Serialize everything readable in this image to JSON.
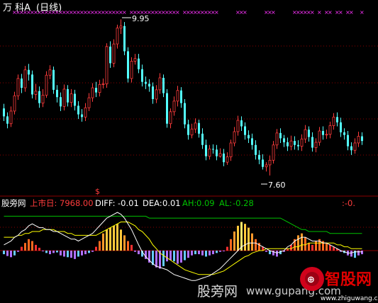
{
  "header": {
    "stock_name": "万 科A",
    "period": "(日线)"
  },
  "price_panel": {
    "high_label": "9.95",
    "low_label": "7.60",
    "signal_glyph": "$"
  },
  "indicator_bar": {
    "name": "股旁网",
    "listing_label": "上市日:",
    "listing_value": "7968.00",
    "diff_label": "DIFF:",
    "diff_value": "-0.01",
    "dea_label": "DEA:",
    "dea_value": "0.01",
    "ah_label": "AH:",
    "ah_value": "0.09",
    "al_label": "AL:",
    "al_value": "-0.28",
    "right_value": ":-0."
  },
  "watermark": {
    "main": "股旁网",
    "domain": "www.gupang.com",
    "site_big": "智股网",
    "site_url": "www.zhiguwang.com"
  },
  "colors": {
    "up": "#ff3c3c",
    "down": "#54ffff",
    "grid": "#8b0000",
    "marker": "#ff33ff",
    "diff": "#ffffff",
    "dea": "#ffff00",
    "ah_color": "#00c000",
    "neg_hist": "#b070ff",
    "neg_hist2": "#66ccff"
  },
  "chart_data": {
    "type": "candlestick",
    "price_range": [
      7.45,
      10.05
    ],
    "candles": [
      [
        8.61,
        8.49,
        8.68,
        8.42
      ],
      [
        8.49,
        8.38,
        8.55,
        8.31
      ],
      [
        8.38,
        8.57,
        8.64,
        8.33
      ],
      [
        8.57,
        8.8,
        8.86,
        8.52
      ],
      [
        8.8,
        9.06,
        9.12,
        8.74
      ],
      [
        9.06,
        8.92,
        9.13,
        8.84
      ],
      [
        8.92,
        9.19,
        9.25,
        8.86
      ],
      [
        9.19,
        9.12,
        9.28,
        9.03
      ],
      [
        9.12,
        8.82,
        9.18,
        8.76
      ],
      [
        8.82,
        8.87,
        8.98,
        8.74
      ],
      [
        8.87,
        8.69,
        8.94,
        8.62
      ],
      [
        8.69,
        8.81,
        8.9,
        8.63
      ],
      [
        8.81,
        9.11,
        9.17,
        8.77
      ],
      [
        9.11,
        9.19,
        9.26,
        9.05
      ],
      [
        9.19,
        8.89,
        9.24,
        8.83
      ],
      [
        8.89,
        8.78,
        8.96,
        8.7
      ],
      [
        8.78,
        8.64,
        8.85,
        8.57
      ],
      [
        8.64,
        8.9,
        8.97,
        8.58
      ],
      [
        8.9,
        8.7,
        8.96,
        8.64
      ],
      [
        8.7,
        8.83,
        8.9,
        8.63
      ],
      [
        8.83,
        8.65,
        8.89,
        8.58
      ],
      [
        8.65,
        8.52,
        8.72,
        8.45
      ],
      [
        8.52,
        8.48,
        8.6,
        8.41
      ],
      [
        8.48,
        8.62,
        8.69,
        8.42
      ],
      [
        8.62,
        8.77,
        8.84,
        8.57
      ],
      [
        8.77,
        8.92,
        8.99,
        8.71
      ],
      [
        8.92,
        8.85,
        9.01,
        8.78
      ],
      [
        8.85,
        8.97,
        9.04,
        8.79
      ],
      [
        8.97,
        8.98,
        9.06,
        8.91
      ],
      [
        8.98,
        9.54,
        9.59,
        8.92
      ],
      [
        9.54,
        9.29,
        9.62,
        9.22
      ],
      [
        9.29,
        9.58,
        9.65,
        9.23
      ],
      [
        9.58,
        9.82,
        9.87,
        9.51
      ],
      [
        9.82,
        9.85,
        9.95,
        9.73
      ],
      [
        9.85,
        9.47,
        9.91,
        9.41
      ],
      [
        9.47,
        9.06,
        9.53,
        9.0
      ],
      [
        9.06,
        9.32,
        9.38,
        9.0
      ],
      [
        9.32,
        9.36,
        9.43,
        9.27
      ],
      [
        9.36,
        9.2,
        9.43,
        9.14
      ],
      [
        9.2,
        9.01,
        9.27,
        8.94
      ],
      [
        9.01,
        8.98,
        9.09,
        8.9
      ],
      [
        8.98,
        8.94,
        9.05,
        8.86
      ],
      [
        8.94,
        8.75,
        9.0,
        8.68
      ],
      [
        8.75,
        8.89,
        8.96,
        8.69
      ],
      [
        8.89,
        9.07,
        9.14,
        8.83
      ],
      [
        9.07,
        8.84,
        9.12,
        8.78
      ],
      [
        8.84,
        8.38,
        8.9,
        8.32
      ],
      [
        8.38,
        8.56,
        8.61,
        8.31
      ],
      [
        8.56,
        8.72,
        8.79,
        8.5
      ],
      [
        8.72,
        8.88,
        8.95,
        8.64
      ],
      [
        8.88,
        8.69,
        8.93,
        8.62
      ],
      [
        8.69,
        8.37,
        8.75,
        8.31
      ],
      [
        8.37,
        8.21,
        8.44,
        8.14
      ],
      [
        8.21,
        8.3,
        8.38,
        8.16
      ],
      [
        8.3,
        8.39,
        8.46,
        8.24
      ],
      [
        8.39,
        8.23,
        8.44,
        8.17
      ],
      [
        8.23,
        8.06,
        8.31,
        8.0
      ],
      [
        8.06,
        7.89,
        8.14,
        7.83
      ],
      [
        7.89,
        8.0,
        8.06,
        7.84
      ],
      [
        8.0,
        7.99,
        8.07,
        7.93
      ],
      [
        7.99,
        7.89,
        8.06,
        7.83
      ],
      [
        7.89,
        7.93,
        8.01,
        7.87
      ],
      [
        7.93,
        7.8,
        8.0,
        7.74
      ],
      [
        7.8,
        7.88,
        7.95,
        7.76
      ],
      [
        7.88,
        8.09,
        8.14,
        7.82
      ],
      [
        8.09,
        8.26,
        8.33,
        8.04
      ],
      [
        8.26,
        8.43,
        8.5,
        8.2
      ],
      [
        8.43,
        8.34,
        8.49,
        8.27
      ],
      [
        8.34,
        8.21,
        8.4,
        8.14
      ],
      [
        8.21,
        8.16,
        8.28,
        8.09
      ],
      [
        8.16,
        8.06,
        8.23,
        7.99
      ],
      [
        8.06,
        7.91,
        8.13,
        7.84
      ],
      [
        7.91,
        7.84,
        7.98,
        7.77
      ],
      [
        7.84,
        7.73,
        7.92,
        7.69
      ],
      [
        7.73,
        7.76,
        7.8,
        7.66
      ],
      [
        7.76,
        7.83,
        7.9,
        7.6
      ],
      [
        7.83,
        8.06,
        8.12,
        7.78
      ],
      [
        8.06,
        8.24,
        8.3,
        8.0
      ],
      [
        8.24,
        8.16,
        8.31,
        8.09
      ],
      [
        8.16,
        8.1,
        8.21,
        8.03
      ],
      [
        8.1,
        8.04,
        8.17,
        7.97
      ],
      [
        8.04,
        8.12,
        8.2,
        7.98
      ],
      [
        8.12,
        8.06,
        8.19,
        7.99
      ],
      [
        8.06,
        8.04,
        8.13,
        7.98
      ],
      [
        8.04,
        8.15,
        8.22,
        7.97
      ],
      [
        8.15,
        8.29,
        8.36,
        8.09
      ],
      [
        8.29,
        8.18,
        8.34,
        8.11
      ],
      [
        8.18,
        8.02,
        8.25,
        7.96
      ],
      [
        8.02,
        8.1,
        8.16,
        7.95
      ],
      [
        8.1,
        8.27,
        8.33,
        8.05
      ],
      [
        8.27,
        8.21,
        8.34,
        8.14
      ],
      [
        8.21,
        8.22,
        8.29,
        8.15
      ],
      [
        8.22,
        8.35,
        8.41,
        8.16
      ],
      [
        8.35,
        8.48,
        8.54,
        8.29
      ],
      [
        8.48,
        8.4,
        8.55,
        8.34
      ],
      [
        8.4,
        8.25,
        8.47,
        8.18
      ],
      [
        8.25,
        8.21,
        8.31,
        8.14
      ],
      [
        8.21,
        8.04,
        8.27,
        7.98
      ],
      [
        8.04,
        7.98,
        8.1,
        7.91
      ],
      [
        7.98,
        8.09,
        8.16,
        7.93
      ],
      [
        8.09,
        8.19,
        8.26,
        8.03
      ],
      [
        8.19,
        8.12,
        8.25,
        8.06
      ]
    ],
    "markers": [
      3,
      4,
      5,
      6,
      7,
      8,
      9,
      10,
      11,
      12,
      13,
      14,
      15,
      16,
      17,
      18,
      19,
      20,
      21,
      22,
      23,
      24,
      25,
      26,
      27,
      28,
      29,
      30,
      31,
      32,
      33,
      34,
      36,
      37,
      38,
      39,
      40,
      41,
      42,
      43,
      44,
      45,
      46,
      47,
      48,
      49,
      51,
      52,
      53,
      54,
      55,
      56,
      57,
      58,
      59,
      60,
      66,
      67,
      68,
      74,
      75,
      76,
      82,
      83,
      84,
      85,
      86,
      87,
      89,
      91,
      92,
      94,
      95,
      97,
      98,
      101
    ],
    "macd": [
      -0.03,
      -0.045,
      -0.055,
      -0.04,
      -0.01,
      0.02,
      0.04,
      0.06,
      0.05,
      0.03,
      0.015,
      -0.005,
      -0.02,
      -0.03,
      -0.02,
      -0.015,
      -0.04,
      -0.05,
      -0.055,
      -0.06,
      -0.07,
      -0.05,
      -0.04,
      -0.03,
      -0.02,
      -0.01,
      0.02,
      0.05,
      0.09,
      0.11,
      0.12,
      0.13,
      0.14,
      0.11,
      0.08,
      0.05,
      0.03,
      -0.01,
      -0.03,
      -0.05,
      -0.07,
      -0.1,
      -0.12,
      -0.14,
      -0.15,
      -0.13,
      -0.09,
      -0.08,
      -0.09,
      -0.11,
      -0.1,
      -0.08,
      -0.06,
      -0.04,
      -0.03,
      -0.03,
      -0.04,
      -0.05,
      -0.04,
      -0.03,
      -0.02,
      -0.01,
      -0.005,
      0.02,
      0.06,
      0.1,
      0.13,
      0.15,
      0.14,
      0.12,
      0.09,
      0.06,
      0.04,
      0.02,
      -0.01,
      -0.03,
      -0.04,
      -0.05,
      -0.03,
      -0.01,
      0.01,
      0.03,
      0.06,
      0.08,
      0.09,
      0.07,
      0.04,
      0.03,
      0.05,
      0.06,
      0.05,
      0.04,
      0.03,
      0.02,
      0.01,
      -0.01,
      -0.02,
      -0.04,
      -0.05,
      -0.06,
      -0.04,
      -0.03
    ],
    "macd_range": [
      -0.26,
      0.2
    ],
    "diff_line": [
      0.03,
      0.04,
      0.05,
      0.07,
      0.08,
      0.1,
      0.11,
      0.13,
      0.14,
      0.13,
      0.12,
      0.12,
      0.11,
      0.11,
      0.1,
      0.1,
      0.09,
      0.08,
      0.07,
      0.06,
      0.06,
      0.05,
      0.06,
      0.07,
      0.08,
      0.09,
      0.11,
      0.13,
      0.15,
      0.17,
      0.18,
      0.19,
      0.2,
      0.19,
      0.17,
      0.14,
      0.11,
      0.07,
      0.03,
      -0.01,
      -0.05,
      -0.08,
      -0.11,
      -0.13,
      -0.14,
      -0.15,
      -0.16,
      -0.18,
      -0.2,
      -0.21,
      -0.22,
      -0.23,
      -0.24,
      -0.25,
      -0.25,
      -0.24,
      -0.23,
      -0.22,
      -0.21,
      -0.19,
      -0.17,
      -0.15,
      -0.12,
      -0.09,
      -0.06,
      -0.03,
      0.0,
      0.02,
      0.03,
      0.04,
      0.04,
      0.04,
      0.03,
      0.02,
      0.01,
      0.0,
      -0.01,
      -0.02,
      -0.01,
      0.0,
      0.02,
      0.03,
      0.05,
      0.06,
      0.07,
      0.07,
      0.06,
      0.05,
      0.05,
      0.05,
      0.04,
      0.04,
      0.03,
      0.02,
      0.01,
      0.0,
      -0.01,
      -0.02,
      -0.02,
      -0.01,
      -0.01,
      -0.01
    ],
    "dea_line": [
      0.07,
      0.07,
      0.07,
      0.07,
      0.08,
      0.08,
      0.09,
      0.09,
      0.1,
      0.1,
      0.1,
      0.11,
      0.11,
      0.11,
      0.11,
      0.1,
      0.1,
      0.1,
      0.09,
      0.09,
      0.08,
      0.08,
      0.08,
      0.08,
      0.08,
      0.08,
      0.08,
      0.09,
      0.1,
      0.11,
      0.12,
      0.13,
      0.14,
      0.15,
      0.15,
      0.15,
      0.14,
      0.13,
      0.11,
      0.1,
      0.08,
      0.06,
      0.03,
      0.01,
      -0.02,
      -0.04,
      -0.06,
      -0.08,
      -0.1,
      -0.12,
      -0.14,
      -0.16,
      -0.17,
      -0.18,
      -0.19,
      -0.2,
      -0.2,
      -0.2,
      -0.2,
      -0.2,
      -0.19,
      -0.18,
      -0.17,
      -0.15,
      -0.13,
      -0.11,
      -0.09,
      -0.07,
      -0.05,
      -0.04,
      -0.02,
      -0.01,
      0.0,
      0.0,
      0.01,
      0.01,
      0.01,
      0.01,
      0.01,
      0.01,
      0.01,
      0.01,
      0.02,
      0.02,
      0.03,
      0.03,
      0.04,
      0.04,
      0.04,
      0.04,
      0.04,
      0.04,
      0.04,
      0.04,
      0.03,
      0.03,
      0.02,
      0.02,
      0.01,
      0.01,
      0.01,
      0.01
    ],
    "ah_line": [
      0.18,
      0.18,
      0.18,
      0.18,
      0.18,
      0.18,
      0.18,
      0.18,
      0.18,
      0.18,
      0.18,
      0.18,
      0.18,
      0.18,
      0.18,
      0.18,
      0.18,
      0.18,
      0.18,
      0.18,
      0.18,
      0.18,
      0.18,
      0.18,
      0.18,
      0.18,
      0.18,
      0.18,
      0.18,
      0.18,
      0.18,
      0.18,
      0.18,
      0.18,
      0.18,
      0.18,
      0.18,
      0.18,
      0.18,
      0.18,
      0.18,
      0.17,
      0.17,
      0.17,
      0.17,
      0.17,
      0.17,
      0.17,
      0.17,
      0.17,
      0.17,
      0.17,
      0.17,
      0.17,
      0.17,
      0.17,
      0.17,
      0.17,
      0.17,
      0.17,
      0.17,
      0.17,
      0.17,
      0.17,
      0.17,
      0.17,
      0.17,
      0.17,
      0.17,
      0.17,
      0.17,
      0.17,
      0.17,
      0.17,
      0.17,
      0.17,
      0.17,
      0.17,
      0.17,
      0.16,
      0.15,
      0.14,
      0.13,
      0.12,
      0.11,
      0.11,
      0.1,
      0.1,
      0.1,
      0.1,
      0.1,
      0.1,
      0.09,
      0.09,
      0.09,
      0.09,
      0.09,
      0.09,
      0.09,
      0.09,
      0.09,
      0.09
    ]
  }
}
